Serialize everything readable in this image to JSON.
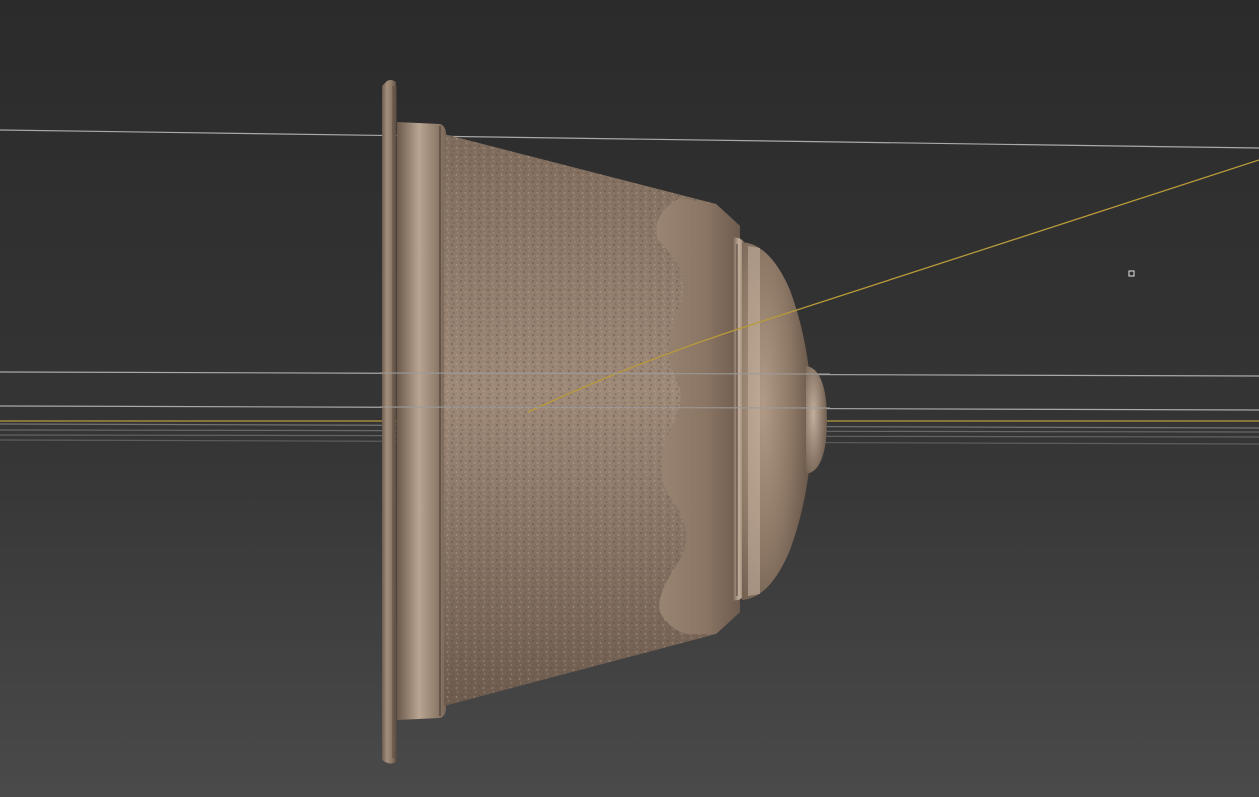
{
  "viewport": {
    "background_top": "#2c2c2c",
    "background_bottom": "#4a4a4a",
    "model": "coffee-capsule",
    "model_color": "#8a7562",
    "model_highlight": "#b8a491",
    "guide_line_color": "#b3b3b3",
    "axis_line_color": "#b89a3a"
  },
  "icons": {
    "handle": "square-handle-icon"
  }
}
